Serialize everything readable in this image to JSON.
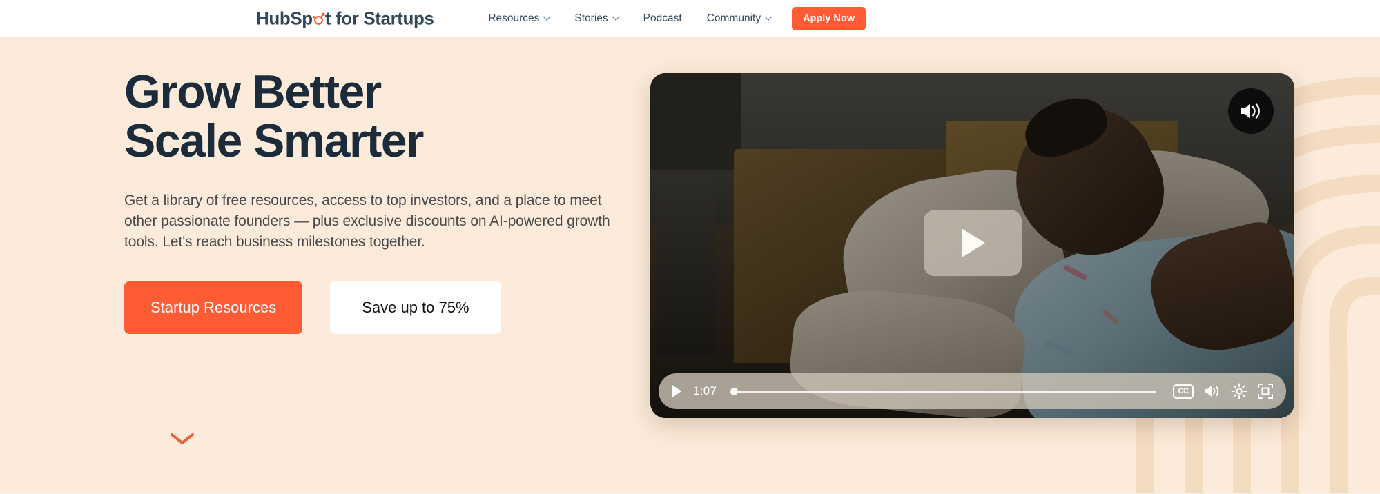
{
  "header": {
    "logo": {
      "prefix": "HubSp",
      "sprocket_icon": "sprocket-o-icon",
      "mid": "t",
      "suffix": "for Startups"
    },
    "nav": [
      {
        "label": "Resources",
        "has_dropdown": true
      },
      {
        "label": "Stories",
        "has_dropdown": true
      },
      {
        "label": "Podcast",
        "has_dropdown": false
      },
      {
        "label": "Community",
        "has_dropdown": true
      }
    ],
    "cta": {
      "label": "Apply Now"
    }
  },
  "hero": {
    "headline": "Grow Better\nScale Smarter",
    "subtext": "Get a library of free resources, access to top investors, and a place to meet other passionate founders — plus exclusive discounts on AI-powered growth tools. Let's reach business milestones together.",
    "buttons": {
      "primary": "Startup Resources",
      "secondary": "Save up to 75%"
    },
    "scroll_hint_icon": "chevron-down-icon"
  },
  "video": {
    "unmute_icon": "volume-on-icon",
    "play_icon": "play-icon",
    "controls": {
      "play_icon": "play-icon",
      "time": "1:07",
      "progress_percent": 0,
      "cc_label": "CC",
      "volume_icon": "volume-on-icon",
      "settings_icon": "gear-icon",
      "fullscreen_icon": "fullscreen-icon"
    }
  },
  "colors": {
    "brand_orange": "#FF5C35",
    "background_cream": "#FCEBDA",
    "arc_cream": "#F6DEC4",
    "text_dark": "#1B2B39",
    "nav_text": "#33475b"
  }
}
